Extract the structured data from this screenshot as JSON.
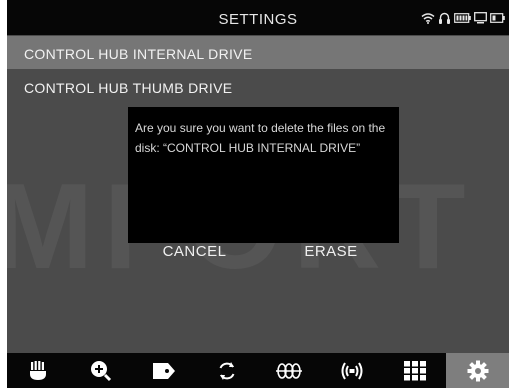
{
  "header": {
    "title": "SETTINGS"
  },
  "status_icons": [
    "wifi-icon",
    "headset-icon",
    "battery-icon",
    "monitor-icon",
    "battery-small-icon"
  ],
  "menu": {
    "items": [
      {
        "label": "CONTROL HUB INTERNAL DRIVE",
        "selected": true
      },
      {
        "label": "CONTROL HUB THUMB DRIVE",
        "selected": false
      }
    ]
  },
  "background_watermark": "OMFORT",
  "dialog": {
    "message": "Are you sure you want to delete the files on the disk: “CONTROL HUB INTERNAL DRIVE”",
    "cancel_label": "CANCEL",
    "erase_label": "ERASE"
  },
  "bottom_nav": {
    "items": [
      "hand-icon",
      "zoom-in-icon",
      "tag-icon",
      "refresh-icon",
      "hearing-loop-icon",
      "broadcast-icon",
      "keypad-icon",
      "gear-icon"
    ],
    "active": "gear-icon"
  },
  "colors": {
    "background": "#4b4b4b",
    "bar": "#060606",
    "selected_row": "#767676",
    "dialog": "#000000",
    "active_tab": "#7e7e7e"
  }
}
